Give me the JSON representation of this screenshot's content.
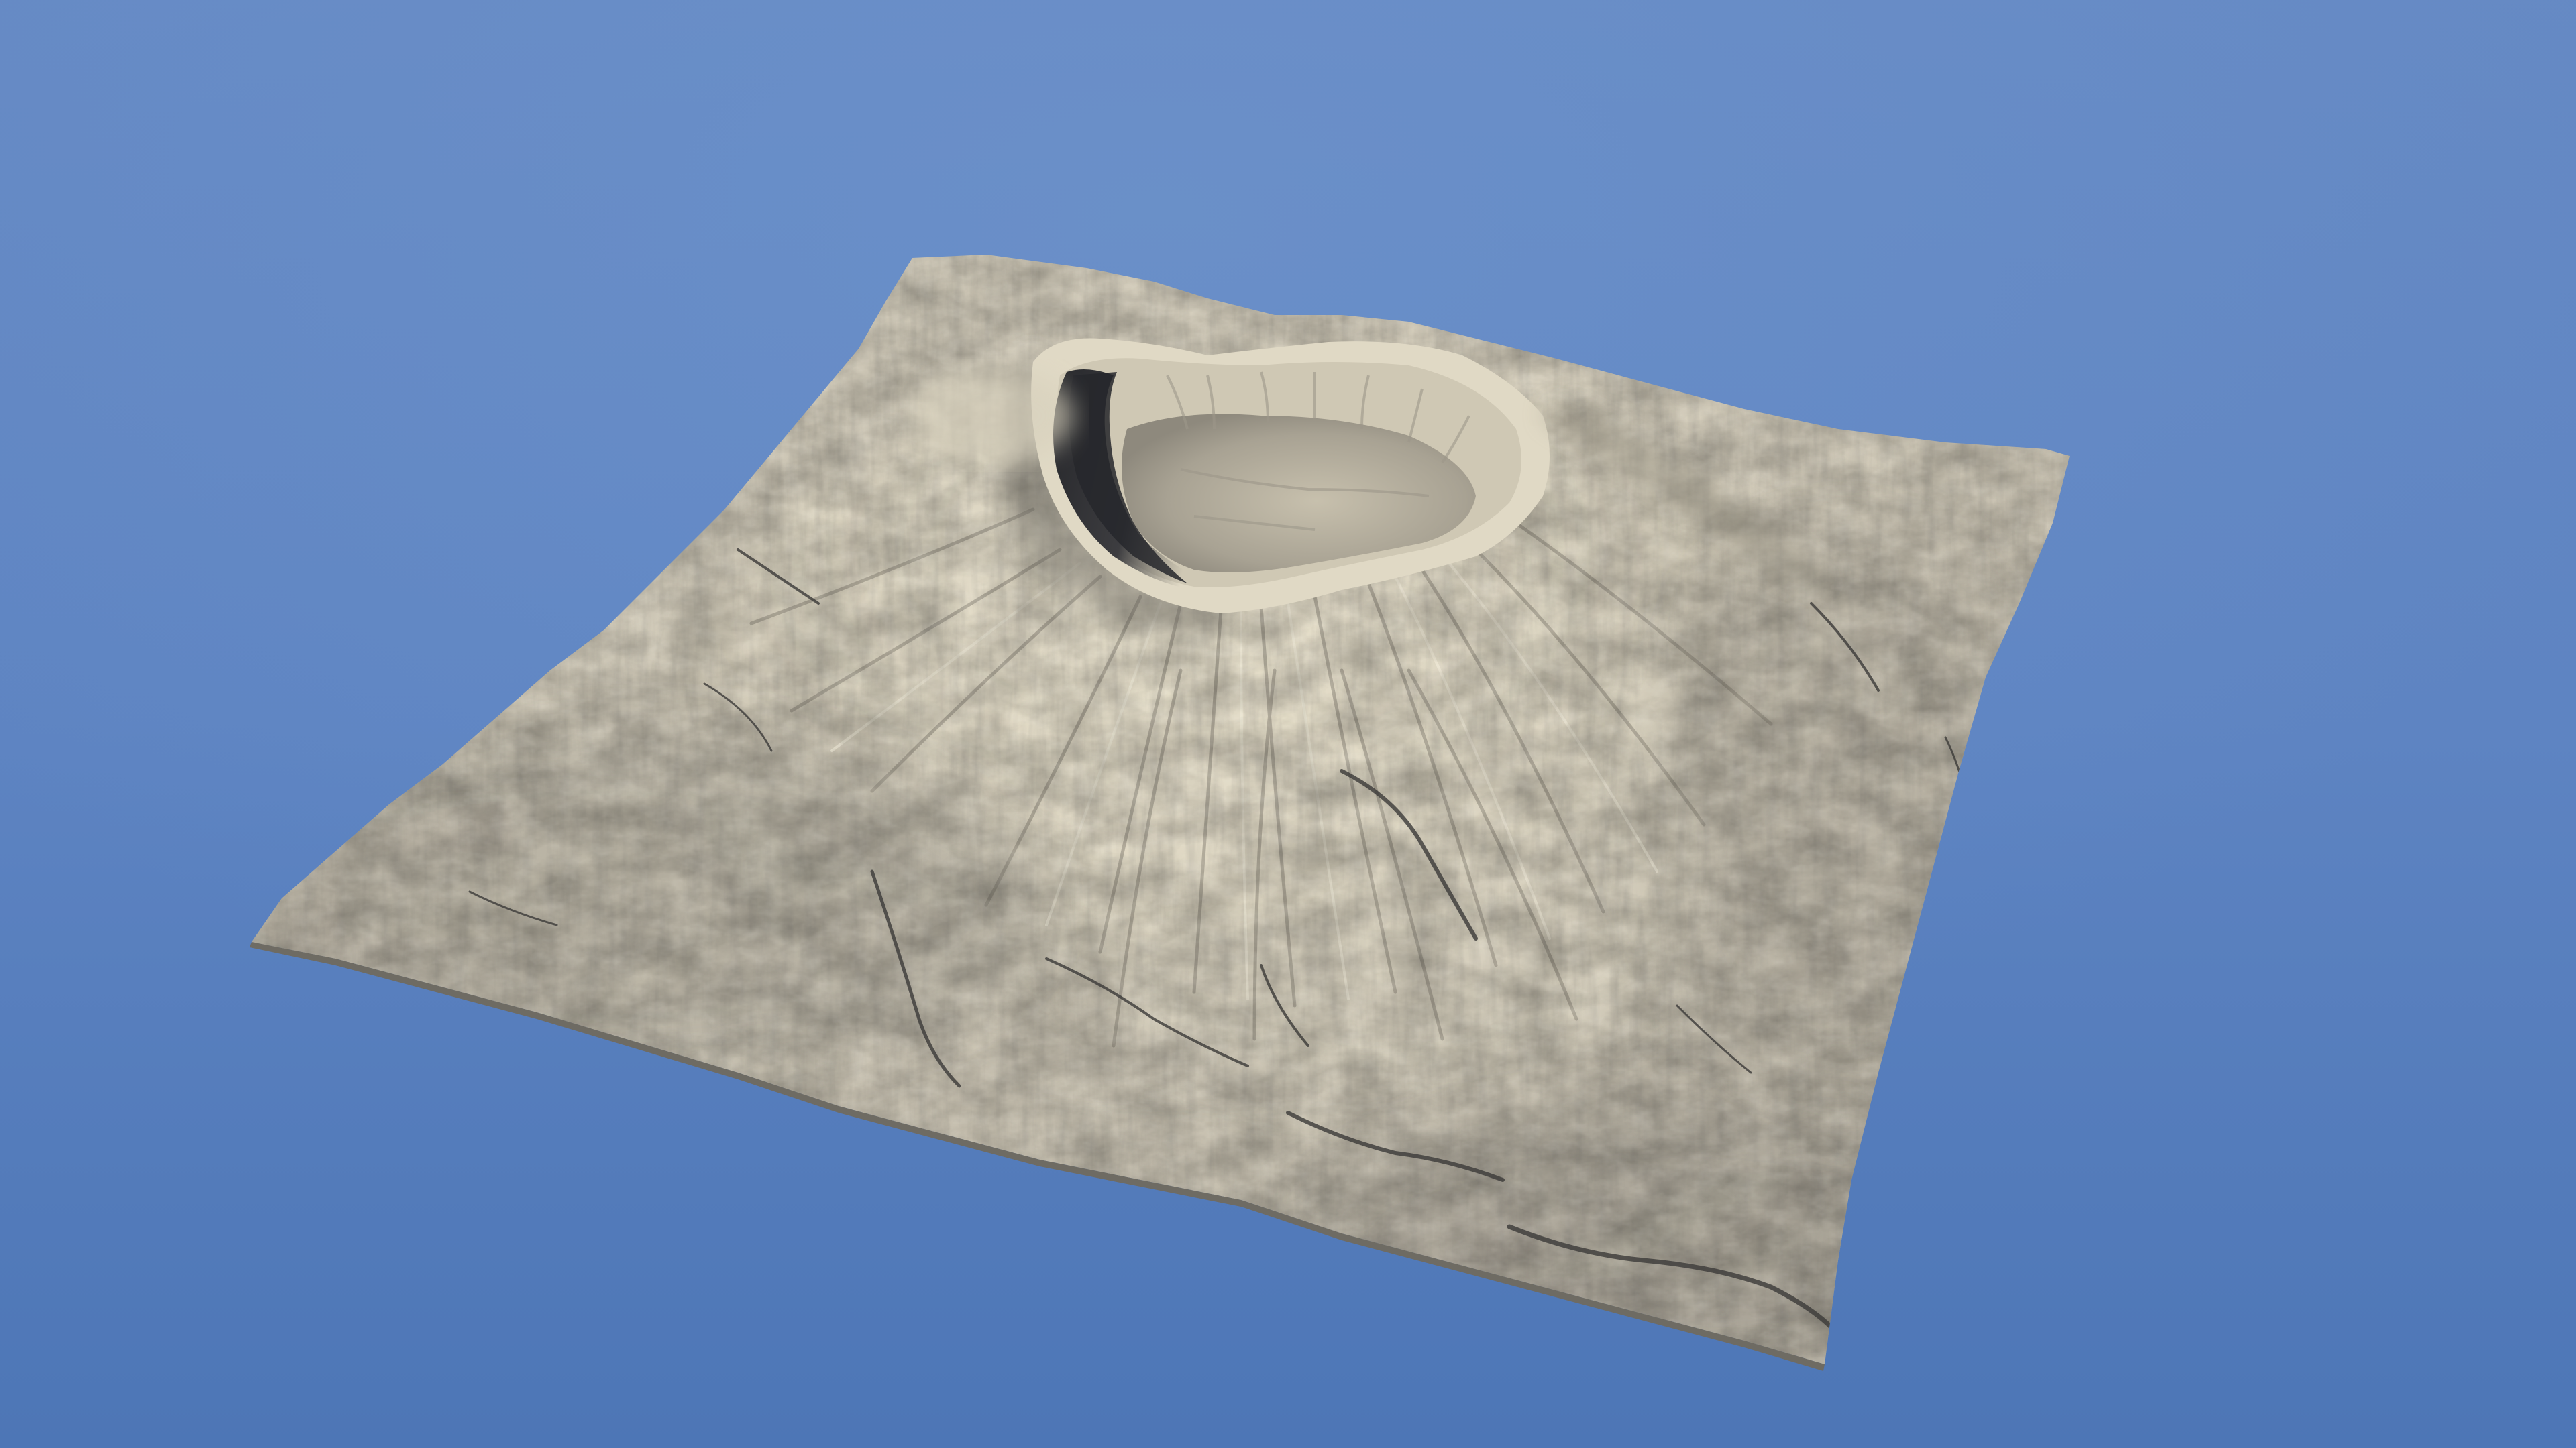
{
  "scene": {
    "sky_top_color": "#6589c4",
    "sky_bottom_color": "#4d76b6",
    "terrain_light_color": "#ddd6c4",
    "terrain_mid_color": "#b9b2a2",
    "terrain_shadow_color": "#5c5a56",
    "crater_shadow_color": "#26272b",
    "subject": "volcano-heightmap-terrain"
  }
}
